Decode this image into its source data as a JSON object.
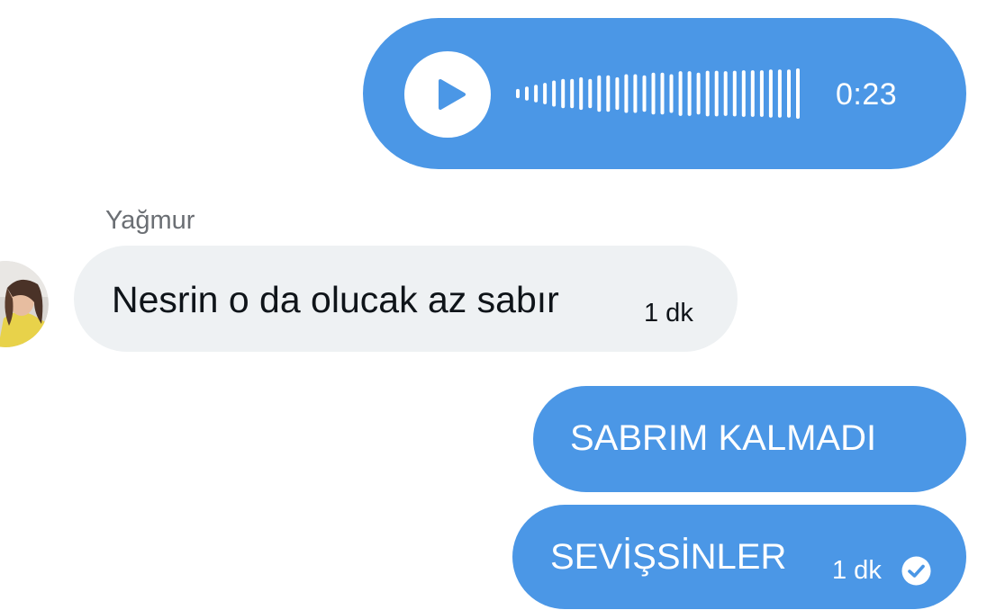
{
  "voice_message": {
    "duration": "0:23",
    "play_icon": "play-icon",
    "waveform_levels": [
      0.12,
      0.22,
      0.3,
      0.38,
      0.48,
      0.55,
      0.55,
      0.62,
      0.55,
      0.7,
      0.7,
      0.62,
      0.75,
      0.75,
      0.7,
      0.82,
      0.82,
      0.75,
      0.88,
      0.88,
      0.82,
      0.9,
      0.9,
      0.88,
      0.9,
      0.92,
      0.92,
      0.92,
      0.95,
      0.95,
      0.95,
      1.0
    ]
  },
  "incoming": {
    "sender": "Yağmur",
    "text": "Nesrin o da olucak az sabır",
    "time": "1 dk",
    "avatar_icon": "avatar-photo"
  },
  "outgoing": [
    {
      "text": "SABRIM KALMADI"
    },
    {
      "text": "SEVİŞSİNLER",
      "time": "1 dk",
      "status_icon": "read-check-icon"
    }
  ],
  "colors": {
    "outgoing_bubble": "#4b97e6",
    "incoming_bubble": "#eef1f3",
    "text_dark": "#0f1419",
    "sender_gray": "#6b6f74"
  }
}
